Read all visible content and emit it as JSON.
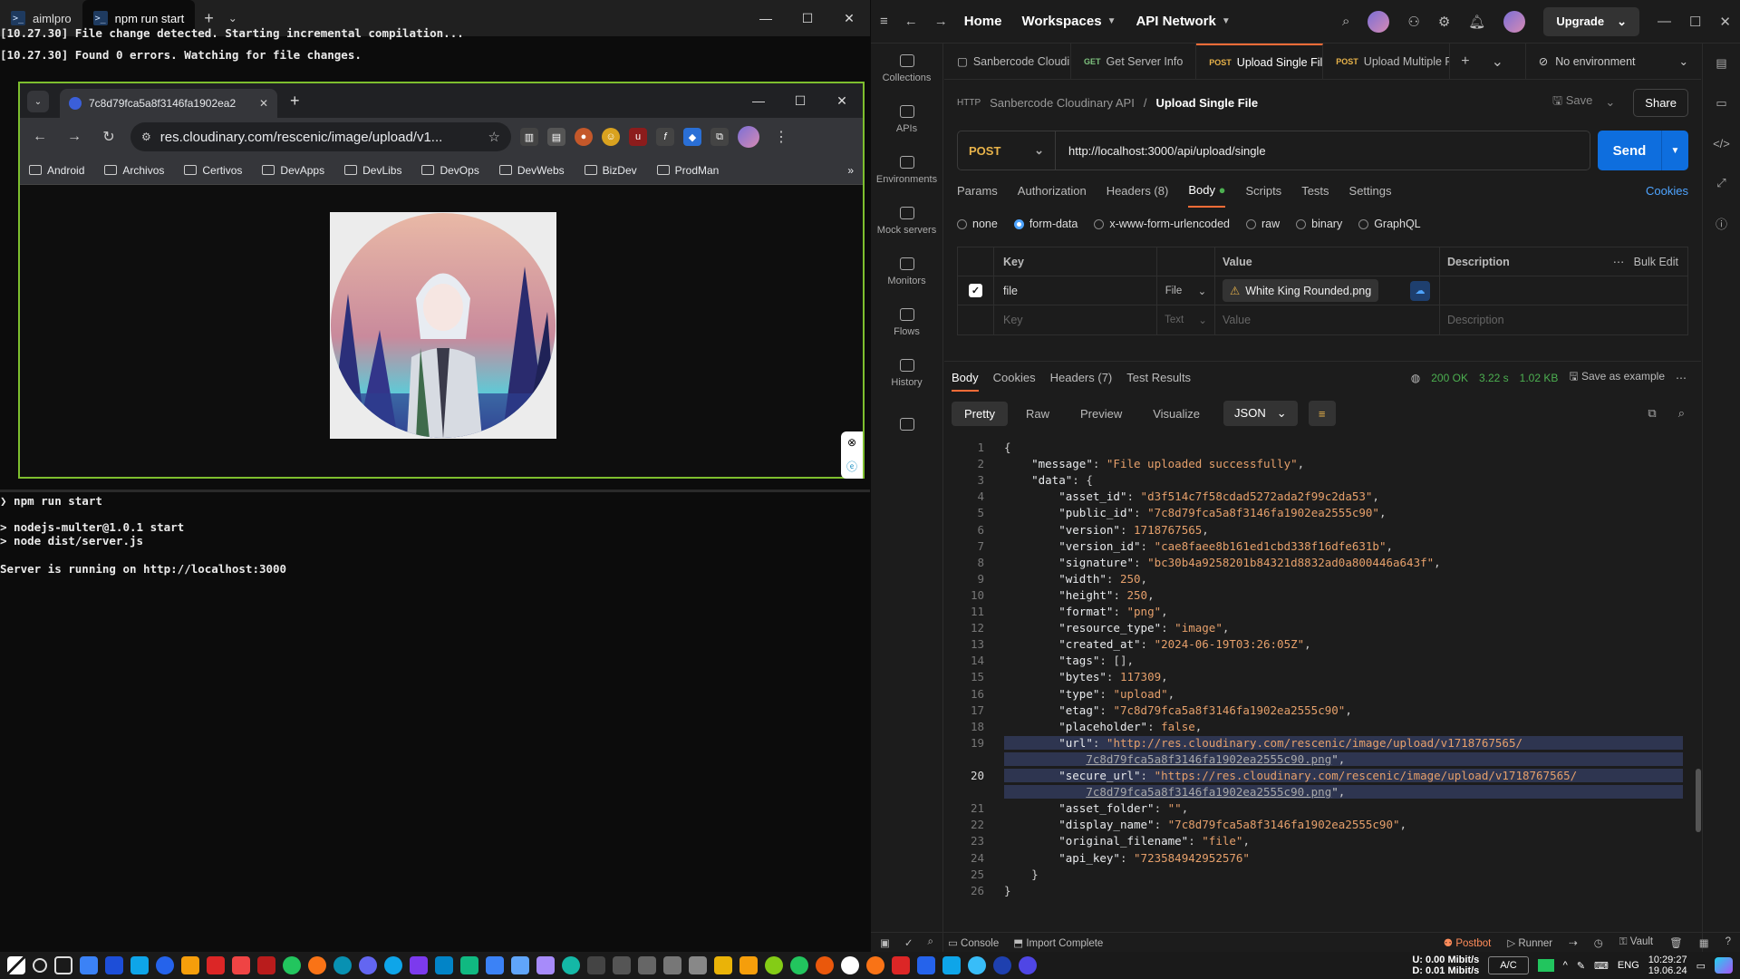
{
  "terminal": {
    "tabs": [
      {
        "label": "aimlpro"
      },
      {
        "label": "npm run start"
      }
    ],
    "lines_top": [
      {
        "ts": "[10.27.30]",
        "text": " File change detected. Starting incremental compilation..."
      },
      {
        "ts": "[10.27.30]",
        "text": " Found 0 errors. Watching for file changes."
      }
    ],
    "lines_bottom": [
      "❯ npm run start",
      "",
      "> nodejs-multer@1.0.1 start",
      "> node dist/server.js",
      "",
      "Server is running on http://localhost:3000"
    ]
  },
  "browser": {
    "tab_title": "7c8d79fca5a8f3146fa1902ea2",
    "url": "res.cloudinary.com/rescenic/image/upload/v1...",
    "bookmarks": [
      "Android",
      "Archivos",
      "Certivos",
      "DevApps",
      "DevLibs",
      "DevOps",
      "DevWebs",
      "BizDev",
      "ProdMan"
    ]
  },
  "postman": {
    "top_nav": {
      "home": "Home",
      "workspaces": "Workspaces",
      "api_network": "API Network",
      "upgrade": "Upgrade"
    },
    "sidebar": [
      "Collections",
      "APIs",
      "Environments",
      "Mock servers",
      "Monitors",
      "Flows",
      "History"
    ],
    "request_tabs": [
      {
        "method": "",
        "label": "Sanbercode Cloudir"
      },
      {
        "method": "GET",
        "label": "Get Server Info"
      },
      {
        "method": "POST",
        "label": "Upload Single File"
      },
      {
        "method": "POST",
        "label": "Upload Multiple Fi"
      }
    ],
    "environment": "No environment",
    "breadcrumb": {
      "collection": "Sanbercode Cloudinary API",
      "request": "Upload Single File"
    },
    "save_label": "Save",
    "share_label": "Share",
    "method": "POST",
    "url": "http://localhost:3000/api/upload/single",
    "send_label": "Send",
    "request_options": {
      "params": "Params",
      "authorization": "Authorization",
      "headers": "Headers (8)",
      "body": "Body",
      "scripts": "Scripts",
      "tests": "Tests",
      "settings": "Settings",
      "cookies": "Cookies"
    },
    "body_types": [
      "none",
      "form-data",
      "x-www-form-urlencoded",
      "raw",
      "binary",
      "GraphQL"
    ],
    "body_type_selected": "form-data",
    "kv_headers": {
      "key": "Key",
      "value": "Value",
      "description": "Description",
      "bulk_edit": "Bulk Edit"
    },
    "kv_rows": [
      {
        "key": "file",
        "type": "File",
        "value": "White King Rounded.png",
        "description": ""
      }
    ],
    "kv_placeholder": {
      "key": "Key",
      "type": "Text",
      "value": "Value",
      "description": "Description"
    },
    "response_tabs": {
      "body": "Body",
      "cookies": "Cookies",
      "headers": "Headers (7)",
      "test_results": "Test Results"
    },
    "response_meta": {
      "status": "200 OK",
      "time": "3.22 s",
      "size": "1.02 KB",
      "save_example": "Save as example"
    },
    "response_formats": [
      "Pretty",
      "Raw",
      "Preview",
      "Visualize"
    ],
    "response_format_selected": "Pretty",
    "response_lang": "JSON",
    "status_bar": {
      "console": "Console",
      "import": "Import Complete",
      "postbot": "Postbot",
      "runner": "Runner",
      "vault": "Vault"
    }
  },
  "response_json_lines": [
    "{",
    "    \"message\": \"File uploaded successfully\",",
    "    \"data\": {",
    "        \"asset_id\": \"d3f514c7f58cdad5272ada2f99c2da53\",",
    "        \"public_id\": \"7c8d79fca5a8f3146fa1902ea2555c90\",",
    "        \"version\": 1718767565,",
    "        \"version_id\": \"cae8faee8b161ed1cbd338f16dfe631b\",",
    "        \"signature\": \"bc30b4a9258201b84321d8832ad0a800446a643f\",",
    "        \"width\": 250,",
    "        \"height\": 250,",
    "        \"format\": \"png\",",
    "        \"resource_type\": \"image\",",
    "        \"created_at\": \"2024-06-19T03:26:05Z\",",
    "        \"tags\": [],",
    "        \"bytes\": 117309,",
    "        \"type\": \"upload\",",
    "        \"etag\": \"7c8d79fca5a8f3146fa1902ea2555c90\",",
    "        \"placeholder\": false,",
    "        \"url\": \"http://res.cloudinary.com/rescenic/image/upload/v1718767565/",
    "            7c8d79fca5a8f3146fa1902ea2555c90.png\",",
    "        \"secure_url\": \"https://res.cloudinary.com/rescenic/image/upload/v1718767565/",
    "            7c8d79fca5a8f3146fa1902ea2555c90.png\",",
    "        \"asset_folder\": \"\",",
    "        \"display_name\": \"7c8d79fca5a8f3146fa1902ea2555c90\",",
    "        \"original_filename\": \"file\",",
    "        \"api_key\": \"723584942952576\"",
    "    }",
    "}"
  ],
  "response_line_numbers": [
    "1",
    "2",
    "3",
    "4",
    "5",
    "6",
    "7",
    "8",
    "9",
    "10",
    "11",
    "12",
    "13",
    "14",
    "15",
    "16",
    "17",
    "18",
    "19",
    "",
    "20",
    "",
    "21",
    "22",
    "23",
    "24",
    "25",
    "26"
  ],
  "taskbar": {
    "net_up": "0.00 Mibit/s",
    "net_down": "0.01 Mibit/s",
    "net_up_label": "U:",
    "net_down_label": "D:",
    "ac": "A/C",
    "lang": "ENG",
    "time": "10:29:27",
    "date": "19.06.24"
  }
}
